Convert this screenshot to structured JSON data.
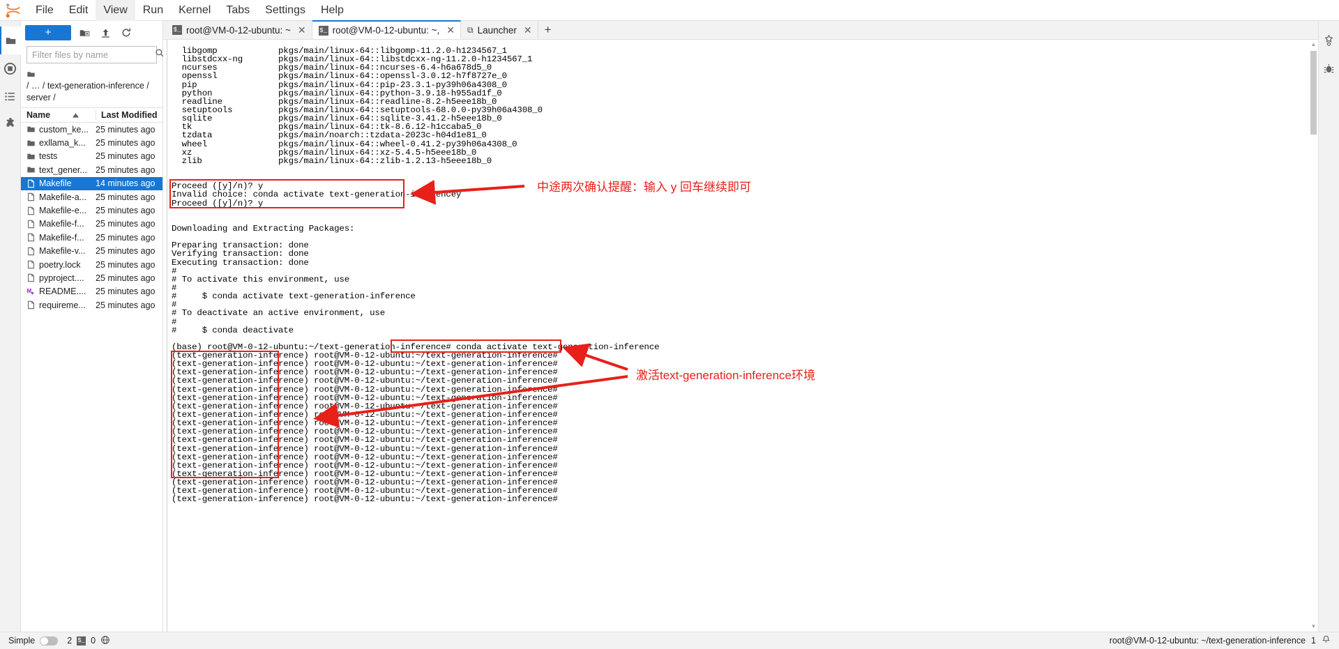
{
  "menubar": {
    "logo_name": "jupyter-logo",
    "items": [
      {
        "label": "File",
        "active": false
      },
      {
        "label": "Edit",
        "active": false
      },
      {
        "label": "View",
        "active": true
      },
      {
        "label": "Run",
        "active": false
      },
      {
        "label": "Kernel",
        "active": false
      },
      {
        "label": "Tabs",
        "active": false
      },
      {
        "label": "Settings",
        "active": false
      },
      {
        "label": "Help",
        "active": false
      }
    ]
  },
  "left_rail": {
    "icons": [
      "file-browser-icon",
      "running-terminals-icon",
      "commands-icon",
      "extensions-icon"
    ]
  },
  "right_rail": {
    "icons": [
      "property-inspector-icon",
      "debugger-icon"
    ]
  },
  "filebrowser": {
    "new_button_label": "+",
    "toolbar_icons": [
      "new-folder-icon",
      "upload-icon",
      "refresh-icon"
    ],
    "filter": {
      "placeholder": "Filter files by name",
      "value": "",
      "search_icon": "search-icon"
    },
    "breadcrumb": {
      "home_icon": "folder-home-icon",
      "parts": [
        "/",
        "…",
        "/",
        "text-generation-inference",
        "/",
        "server",
        "/"
      ],
      "text": "/ … / text-generation-inference / server /"
    },
    "columns": {
      "name": "Name",
      "modified": "Last Modified",
      "sort_icon": "sort-asc-icon"
    },
    "items": [
      {
        "name": "custom_ke...",
        "modified": "25 minutes ago",
        "type": "folder",
        "selected": false
      },
      {
        "name": "exllama_k...",
        "modified": "25 minutes ago",
        "type": "folder",
        "selected": false
      },
      {
        "name": "tests",
        "modified": "25 minutes ago",
        "type": "folder",
        "selected": false
      },
      {
        "name": "text_gener...",
        "modified": "25 minutes ago",
        "type": "folder",
        "selected": false
      },
      {
        "name": "Makefile",
        "modified": "14 minutes ago",
        "type": "file",
        "selected": true
      },
      {
        "name": "Makefile-a...",
        "modified": "25 minutes ago",
        "type": "file",
        "selected": false
      },
      {
        "name": "Makefile-e...",
        "modified": "25 minutes ago",
        "type": "file",
        "selected": false
      },
      {
        "name": "Makefile-f...",
        "modified": "25 minutes ago",
        "type": "file",
        "selected": false
      },
      {
        "name": "Makefile-f...",
        "modified": "25 minutes ago",
        "type": "file",
        "selected": false
      },
      {
        "name": "Makefile-v...",
        "modified": "25 minutes ago",
        "type": "file",
        "selected": false
      },
      {
        "name": "poetry.lock",
        "modified": "25 minutes ago",
        "type": "file",
        "selected": false
      },
      {
        "name": "pyproject....",
        "modified": "25 minutes ago",
        "type": "file",
        "selected": false
      },
      {
        "name": "README....",
        "modified": "25 minutes ago",
        "type": "markdown",
        "selected": false
      },
      {
        "name": "requireme...",
        "modified": "25 minutes ago",
        "type": "file",
        "selected": false
      }
    ]
  },
  "tabs": {
    "items": [
      {
        "label": "root@VM-0-12-ubuntu: ~",
        "icon": "terminal-icon",
        "active": false,
        "close_icon": "close-icon"
      },
      {
        "label": "root@VM-0-12-ubuntu: ~,",
        "icon": "terminal-icon",
        "active": true,
        "close_icon": "close-icon"
      },
      {
        "label": "Launcher",
        "icon": "launcher-icon",
        "active": false,
        "close_icon": "close-icon"
      }
    ],
    "add_label": "+"
  },
  "terminal": {
    "lines": [
      "  libgomp            pkgs/main/linux-64::libgomp-11.2.0-h1234567_1",
      "  libstdcxx-ng       pkgs/main/linux-64::libstdcxx-ng-11.2.0-h1234567_1",
      "  ncurses            pkgs/main/linux-64::ncurses-6.4-h6a678d5_0",
      "  openssl            pkgs/main/linux-64::openssl-3.0.12-h7f8727e_0",
      "  pip                pkgs/main/linux-64::pip-23.3.1-py39h06a4308_0",
      "  python             pkgs/main/linux-64::python-3.9.18-h955ad1f_0",
      "  readline           pkgs/main/linux-64::readline-8.2-h5eee18b_0",
      "  setuptools         pkgs/main/linux-64::setuptools-68.0.0-py39h06a4308_0",
      "  sqlite             pkgs/main/linux-64::sqlite-3.41.2-h5eee18b_0",
      "  tk                 pkgs/main/linux-64::tk-8.6.12-h1ccaba5_0",
      "  tzdata             pkgs/main/noarch::tzdata-2023c-h04d1e81_0",
      "  wheel              pkgs/main/linux-64::wheel-0.41.2-py39h06a4308_0",
      "  xz                 pkgs/main/linux-64::xz-5.4.5-h5eee18b_0",
      "  zlib               pkgs/main/linux-64::zlib-1.2.13-h5eee18b_0",
      "",
      "",
      "Proceed ([y]/n)? y",
      "Invalid choice: conda activate text-generation-inferencey",
      "Proceed ([y]/n)? y",
      "",
      "",
      "Downloading and Extracting Packages:",
      "",
      "Preparing transaction: done",
      "Verifying transaction: done",
      "Executing transaction: done",
      "#",
      "# To activate this environment, use",
      "#",
      "#     $ conda activate text-generation-inference",
      "#",
      "# To deactivate an active environment, use",
      "#",
      "#     $ conda deactivate",
      "",
      "(base) root@VM-0-12-ubuntu:~/text-generation-inference# conda activate text-generation-inference",
      "(text-generation-inference) root@VM-0-12-ubuntu:~/text-generation-inference#",
      "(text-generation-inference) root@VM-0-12-ubuntu:~/text-generation-inference#",
      "(text-generation-inference) root@VM-0-12-ubuntu:~/text-generation-inference#",
      "(text-generation-inference) root@VM-0-12-ubuntu:~/text-generation-inference#",
      "(text-generation-inference) root@VM-0-12-ubuntu:~/text-generation-inference#",
      "(text-generation-inference) root@VM-0-12-ubuntu:~/text-generation-inference#",
      "(text-generation-inference) root@VM-0-12-ubuntu:~/text-generation-inference#",
      "(text-generation-inference) root@VM-0-12-ubuntu:~/text-generation-inference#",
      "(text-generation-inference) root@VM-0-12-ubuntu:~/text-generation-inference#",
      "(text-generation-inference) root@VM-0-12-ubuntu:~/text-generation-inference#",
      "(text-generation-inference) root@VM-0-12-ubuntu:~/text-generation-inference#",
      "(text-generation-inference) root@VM-0-12-ubuntu:~/text-generation-inference#",
      "(text-generation-inference) root@VM-0-12-ubuntu:~/text-generation-inference#",
      "(text-generation-inference) root@VM-0-12-ubuntu:~/text-generation-inference#",
      "(text-generation-inference) root@VM-0-12-ubuntu:~/text-generation-inference#",
      "(text-generation-inference) root@VM-0-12-ubuntu:~/text-generation-inference#",
      "(text-generation-inference) root@VM-0-12-ubuntu:~/text-generation-inference#",
      "(text-generation-inference) root@VM-0-12-ubuntu:~/text-generation-inference#"
    ]
  },
  "annotations": {
    "accent_color": "#e8201a",
    "proceed_note": "中途两次确认提醒：输入 y 回车继续即可",
    "activate_note": "激活text-generation-inference环境"
  },
  "statusbar": {
    "mode_label": "Simple",
    "terminal_count": "2",
    "kernel_count": "0",
    "toggle_on": false,
    "chip_icon": "terminal-icon",
    "globe_icon": "globe-icon",
    "path": "root@VM-0-12-ubuntu: ~/text-generation-inference",
    "notifications": "1",
    "bell_icon": "bell-icon"
  }
}
